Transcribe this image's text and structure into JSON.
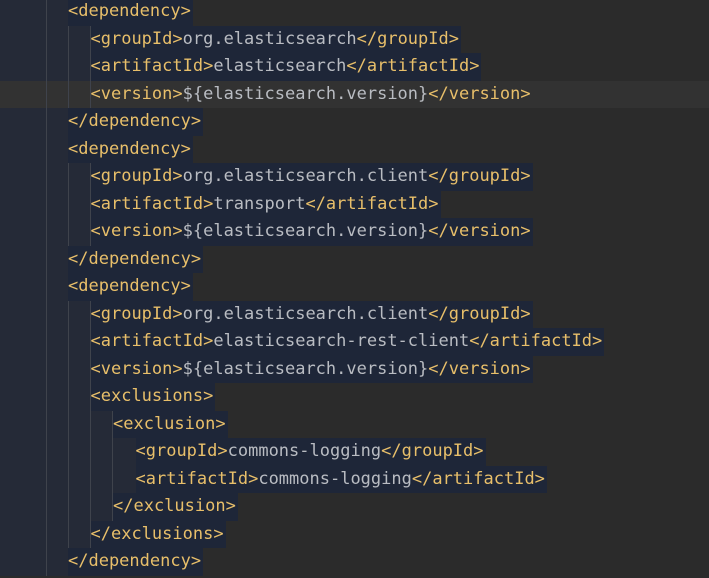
{
  "colors": {
    "background": "#2b2b2b",
    "line_block_background": "#1e2638",
    "caret_line_background": "#323232",
    "tag": "#e8bf6a",
    "text": "#b9bcc2"
  },
  "lines": [
    {
      "depth": 1,
      "open": "<dependency>",
      "text": "",
      "close": ""
    },
    {
      "depth": 2,
      "open": "<groupId>",
      "text": "org.elasticsearch",
      "close": "</groupId>"
    },
    {
      "depth": 2,
      "open": "<artifactId>",
      "text": "elasticsearch",
      "close": "</artifactId>"
    },
    {
      "depth": 2,
      "open": "<version>",
      "text": "${elasticsearch.version}",
      "close": "</version>",
      "caret": true
    },
    {
      "depth": 1,
      "open": "</dependency>",
      "text": "",
      "close": ""
    },
    {
      "depth": 1,
      "open": "<dependency>",
      "text": "",
      "close": ""
    },
    {
      "depth": 2,
      "open": "<groupId>",
      "text": "org.elasticsearch.client",
      "close": "</groupId>"
    },
    {
      "depth": 2,
      "open": "<artifactId>",
      "text": "transport",
      "close": "</artifactId>"
    },
    {
      "depth": 2,
      "open": "<version>",
      "text": "${elasticsearch.version}",
      "close": "</version>"
    },
    {
      "depth": 1,
      "open": "</dependency>",
      "text": "",
      "close": ""
    },
    {
      "depth": 1,
      "open": "<dependency>",
      "text": "",
      "close": ""
    },
    {
      "depth": 2,
      "open": "<groupId>",
      "text": "org.elasticsearch.client",
      "close": "</groupId>"
    },
    {
      "depth": 2,
      "open": "<artifactId>",
      "text": "elasticsearch-rest-client",
      "close": "</artifactId>"
    },
    {
      "depth": 2,
      "open": "<version>",
      "text": "${elasticsearch.version}",
      "close": "</version>"
    },
    {
      "depth": 2,
      "open": "<exclusions>",
      "text": "",
      "close": ""
    },
    {
      "depth": 3,
      "open": "<exclusion>",
      "text": "",
      "close": ""
    },
    {
      "depth": 4,
      "open": "<groupId>",
      "text": "commons-logging",
      "close": "</groupId>"
    },
    {
      "depth": 4,
      "open": "<artifactId>",
      "text": "commons-logging",
      "close": "</artifactId>"
    },
    {
      "depth": 3,
      "open": "</exclusion>",
      "text": "",
      "close": ""
    },
    {
      "depth": 2,
      "open": "</exclusions>",
      "text": "",
      "close": ""
    },
    {
      "depth": 1,
      "open": "</dependency>",
      "text": "",
      "close": ""
    }
  ]
}
